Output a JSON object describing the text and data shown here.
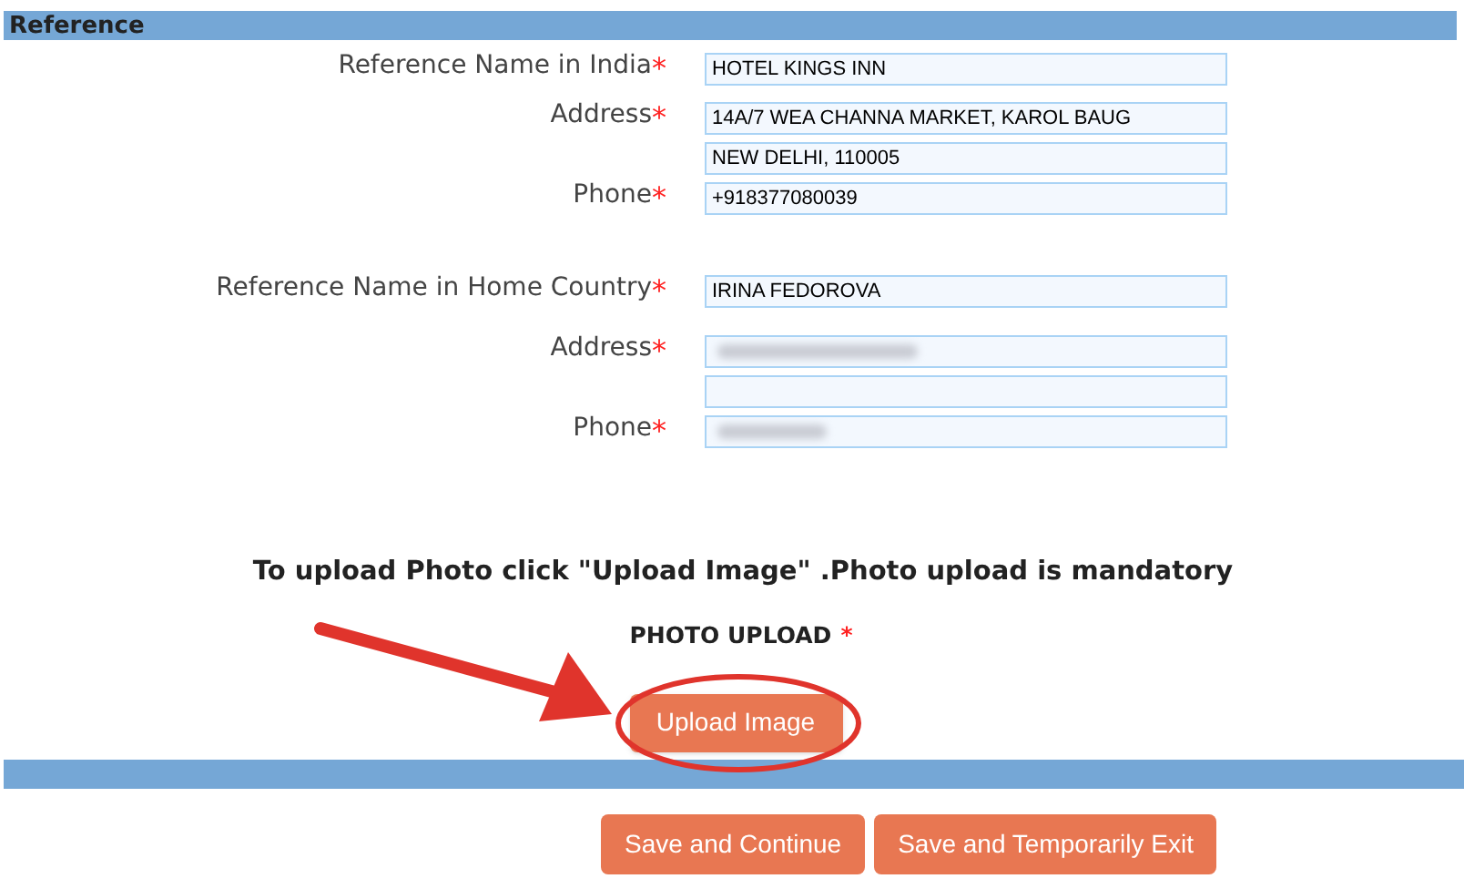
{
  "section": {
    "title": "Reference"
  },
  "groups": [
    {
      "rows": [
        {
          "label": "Reference Name in India",
          "required_mark": "*",
          "value": "HOTEL KINGS INN",
          "blurred": false
        },
        {
          "label": "Address",
          "required_mark": "*",
          "value": "14A/7 WEA CHANNA MARKET, KAROL BAUG",
          "blurred": false
        },
        {
          "value": "NEW DELHI, 110005",
          "blurred": false
        },
        {
          "label": "Phone",
          "required_mark": "*",
          "value": "+918377080039",
          "blurred": false
        }
      ]
    },
    {
      "rows": [
        {
          "label": "Reference Name in Home Country",
          "required_mark": "*",
          "value": "IRINA FEDOROVA",
          "blurred": false
        },
        {
          "label": "Address",
          "required_mark": "*",
          "blurred": true
        },
        {
          "blurred": false
        },
        {
          "label": "Phone",
          "required_mark": "*",
          "blurred": true
        }
      ]
    }
  ],
  "upload": {
    "instruction": "To upload Photo click \"Upload Image\" .Photo upload is mandatory",
    "label": "PHOTO UPLOAD",
    "required_mark": "*",
    "button": "Upload Image",
    "highlighted": true
  },
  "buttons": [
    "Save and Continue",
    "Save and Temporarily Exit"
  ]
}
